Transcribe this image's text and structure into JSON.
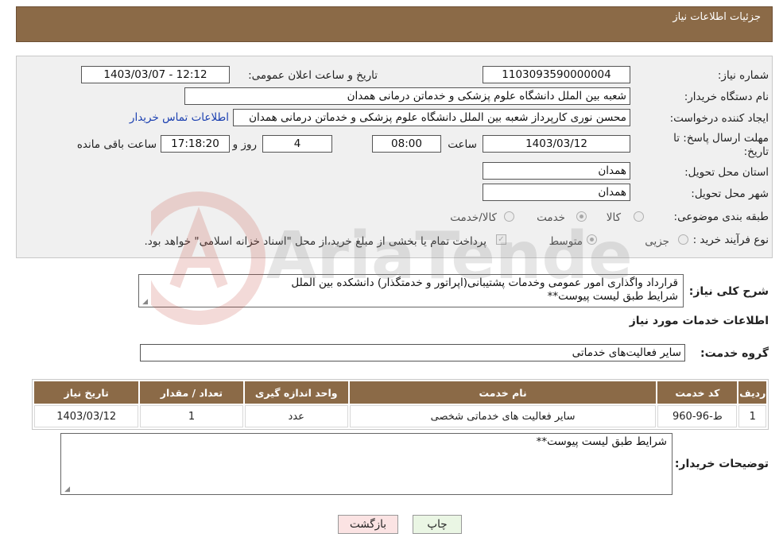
{
  "header": {
    "title": "جزئیات اطلاعات نیاز"
  },
  "fields": {
    "need_number_label": "شماره نیاز:",
    "need_number": "1103093590000004",
    "announce_label": "تاریخ و ساعت اعلان عمومی:",
    "announce_value": "1403/03/07 - 12:12",
    "buyer_org_label": "نام دستگاه خریدار:",
    "buyer_org": "شعبه بین الملل دانشگاه علوم پزشکی و خدماتن درمانی همدان",
    "creator_label": "ایجاد کننده درخواست:",
    "creator": "محسن نوری کارپرداز شعبه بین الملل دانشگاه علوم پزشکی و خدماتن درمانی همدان",
    "contact_link": "اطلاعات تماس خریدار",
    "deadline_label_line1": "مهلت ارسال پاسخ: تا",
    "deadline_label_line2": "تاریخ:",
    "deadline_date": "1403/03/12",
    "time_label": "ساعت",
    "deadline_time": "08:00",
    "days_value": "4",
    "days_label": "روز و",
    "remaining_time": "17:18:20",
    "remaining_label": "ساعت باقی مانده",
    "province_label": "استان محل تحویل:",
    "province": "همدان",
    "city_label": "شهر محل تحویل:",
    "city": "همدان",
    "category_label": "طبقه بندی موضوعی:",
    "category_options": [
      "کالا",
      "خدمت",
      "کالا/خدمت"
    ],
    "category_selected": "خدمت",
    "process_label": "نوع فرآیند خرید :",
    "process_options": [
      "جزیی",
      "متوسط"
    ],
    "process_selected": "متوسط",
    "payment_note": "پرداخت تمام یا بخشی از مبلغ خرید،از محل \"اسناد خزانه اسلامی\" خواهد بود."
  },
  "summary": {
    "label": "شرح کلی نیاز:",
    "text_line1": "قرارداد واگذاری امور عمومی وخدمات پشتیبانی(اپراتور و خدمتگذار) دانشکده بین الملل",
    "text_line2": "شرایط طبق لیست پیوست**"
  },
  "services_section": {
    "title": "اطلاعات خدمات مورد نیاز",
    "group_label": "گروه خدمت:",
    "group_value": "سایر فعالیت‌های خدماتی"
  },
  "table": {
    "headers": [
      "ردیف",
      "کد خدمت",
      "نام خدمت",
      "واحد اندازه گیری",
      "تعداد / مقدار",
      "تاریخ نیاز"
    ],
    "rows": [
      [
        "1",
        "ط-96-960",
        "سایر فعالیت های خدماتی شخصی",
        "عدد",
        "1",
        "1403/03/12"
      ]
    ]
  },
  "buyer_notes": {
    "label": "توضیحات خریدار:",
    "text": "شرایط طبق لیست پیوست**"
  },
  "buttons": {
    "print": "چاپ",
    "back": "بازگشت"
  },
  "watermark": {
    "text": "AriaTender.net"
  },
  "colors": {
    "header_brown": "#8b6a47",
    "link_blue": "#1a3fb0"
  }
}
